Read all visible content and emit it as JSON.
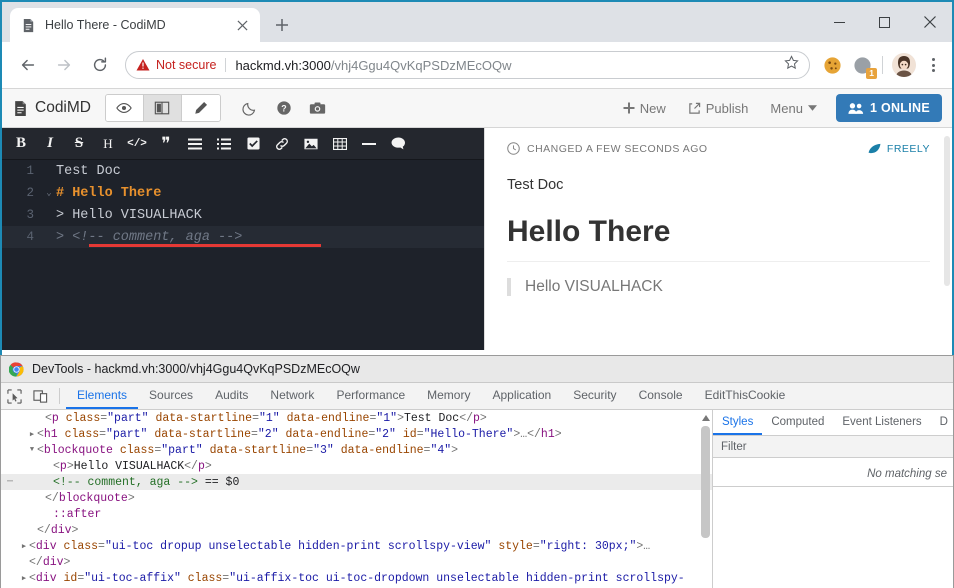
{
  "browser": {
    "tab": {
      "title": "Hello There - CodiMD",
      "favicon": "document-icon",
      "close": "×"
    },
    "new_tab_label": "+",
    "window_controls": {
      "minimize": "—",
      "maximize": "□",
      "close": "✕"
    },
    "nav": {
      "back": "←",
      "forward": "→",
      "reload": "⟳"
    },
    "omnibox": {
      "security_label": "Not secure",
      "url_host": "hackmd.vh:3000",
      "url_path": "/vhj4Ggu4QvKqPSDzMEcOQw",
      "full_url": "hackmd.vh:3000/vhj4Ggu4QvKqPSDzMEcOQw",
      "star": "☆"
    },
    "extensions": [
      {
        "name": "cookie-extension-icon",
        "badge": ""
      },
      {
        "name": "extension-icon",
        "badge": "1"
      }
    ]
  },
  "codimd": {
    "brand": "CodiMD",
    "modes": [
      {
        "name": "view-mode-button",
        "icon": "eye-icon",
        "active": false
      },
      {
        "name": "both-mode-button",
        "icon": "columns-icon",
        "active": true
      },
      {
        "name": "edit-mode-button",
        "icon": "pencil-icon",
        "active": false
      }
    ],
    "nav_icons": [
      {
        "name": "night-mode-button",
        "icon": "moon-icon"
      },
      {
        "name": "help-button",
        "icon": "question-circle-icon"
      },
      {
        "name": "snapshot-button",
        "icon": "camera-icon"
      }
    ],
    "actions": [
      {
        "name": "new-button",
        "label": "New",
        "icon": "plus-icon"
      },
      {
        "name": "publish-button",
        "label": "Publish",
        "icon": "share-icon"
      },
      {
        "name": "menu-button",
        "label": "Menu",
        "icon": "caret-down-icon"
      }
    ],
    "online_badge": {
      "label": "1 ONLINE",
      "icon": "users-icon",
      "color": "#337ab7"
    }
  },
  "editor": {
    "toolbar": [
      {
        "name": "bold-button",
        "glyph": "B"
      },
      {
        "name": "italic-button",
        "glyph": "I"
      },
      {
        "name": "strikethrough-button",
        "glyph": "S"
      },
      {
        "name": "heading-button",
        "glyph": "H"
      },
      {
        "name": "code-button",
        "glyph": "</>"
      },
      {
        "name": "quote-button",
        "glyph": "❞"
      },
      {
        "name": "unordered-list-button",
        "glyph": "☰"
      },
      {
        "name": "ordered-list-button",
        "glyph": "☰"
      },
      {
        "name": "check-list-button",
        "glyph": "☑"
      },
      {
        "name": "link-button",
        "glyph": "🔗"
      },
      {
        "name": "image-button",
        "glyph": "🖼"
      },
      {
        "name": "table-button",
        "glyph": "▦"
      },
      {
        "name": "horizontal-rule-button",
        "glyph": "—"
      },
      {
        "name": "comment-button",
        "glyph": "💬"
      }
    ],
    "lines": [
      {
        "num": "1",
        "fold": "",
        "text": "Test Doc",
        "type": "plain",
        "selected": false
      },
      {
        "num": "2",
        "fold": "⌄",
        "text": "# Hello There",
        "type": "heading",
        "selected": false
      },
      {
        "num": "3",
        "fold": "",
        "text": "> Hello VISUALHACK",
        "type": "quote",
        "selected": false
      },
      {
        "num": "4",
        "fold": "",
        "text": "> <!-- comment, aga -->",
        "type": "quotecomment",
        "selected": true
      }
    ]
  },
  "preview": {
    "status": "CHANGED A FEW SECONDS AGO",
    "status_icon": "clock-icon",
    "permission": "FREELY",
    "permission_icon": "leaf-icon",
    "paragraph": "Test Doc",
    "heading": "Hello There",
    "blockquote": "Hello VISUALHACK"
  },
  "devtools": {
    "title": "DevTools - hackmd.vh:3000/vhj4Ggu4QvKqPSDzMEcOQw",
    "tool_icons": [
      {
        "name": "inspect-element-icon"
      },
      {
        "name": "device-toolbar-icon"
      }
    ],
    "tabs": [
      {
        "label": "Elements",
        "active": true
      },
      {
        "label": "Sources",
        "active": false
      },
      {
        "label": "Audits",
        "active": false
      },
      {
        "label": "Network",
        "active": false
      },
      {
        "label": "Performance",
        "active": false
      },
      {
        "label": "Memory",
        "active": false
      },
      {
        "label": "Application",
        "active": false
      },
      {
        "label": "Security",
        "active": false
      },
      {
        "label": "Console",
        "active": false
      },
      {
        "label": "EditThisCookie",
        "active": false
      }
    ],
    "dom_lines": [
      {
        "indent": 44,
        "arrow": "",
        "gutter": "",
        "selected": false,
        "parts": [
          {
            "t": "punct",
            "v": "<"
          },
          {
            "t": "tag",
            "v": "p"
          },
          {
            "t": "attr",
            "v": " class"
          },
          {
            "t": "punct",
            "v": "="
          },
          {
            "t": "val",
            "v": "\"part\""
          },
          {
            "t": "attr",
            "v": " data-startline"
          },
          {
            "t": "punct",
            "v": "="
          },
          {
            "t": "val",
            "v": "\"1\""
          },
          {
            "t": "attr",
            "v": " data-endline"
          },
          {
            "t": "punct",
            "v": "="
          },
          {
            "t": "val",
            "v": "\"1\""
          },
          {
            "t": "punct",
            "v": ">"
          },
          {
            "t": "text",
            "v": "Test Doc"
          },
          {
            "t": "punct",
            "v": "</"
          },
          {
            "t": "tag",
            "v": "p"
          },
          {
            "t": "punct",
            "v": ">"
          }
        ]
      },
      {
        "indent": 36,
        "arrow": "▶",
        "gutter": "",
        "selected": false,
        "parts": [
          {
            "t": "punct",
            "v": "<"
          },
          {
            "t": "tag",
            "v": "h1"
          },
          {
            "t": "attr",
            "v": " class"
          },
          {
            "t": "punct",
            "v": "="
          },
          {
            "t": "val",
            "v": "\"part\""
          },
          {
            "t": "attr",
            "v": " data-startline"
          },
          {
            "t": "punct",
            "v": "="
          },
          {
            "t": "val",
            "v": "\"2\""
          },
          {
            "t": "attr",
            "v": " data-endline"
          },
          {
            "t": "punct",
            "v": "="
          },
          {
            "t": "val",
            "v": "\"2\""
          },
          {
            "t": "attr",
            "v": " id"
          },
          {
            "t": "punct",
            "v": "="
          },
          {
            "t": "val",
            "v": "\"Hello-There\""
          },
          {
            "t": "punct",
            "v": ">…</"
          },
          {
            "t": "tag",
            "v": "h1"
          },
          {
            "t": "punct",
            "v": ">"
          }
        ]
      },
      {
        "indent": 36,
        "arrow": "▼",
        "gutter": "",
        "selected": false,
        "parts": [
          {
            "t": "punct",
            "v": "<"
          },
          {
            "t": "tag",
            "v": "blockquote"
          },
          {
            "t": "attr",
            "v": " class"
          },
          {
            "t": "punct",
            "v": "="
          },
          {
            "t": "val",
            "v": "\"part\""
          },
          {
            "t": "attr",
            "v": " data-startline"
          },
          {
            "t": "punct",
            "v": "="
          },
          {
            "t": "val",
            "v": "\"3\""
          },
          {
            "t": "attr",
            "v": " data-endline"
          },
          {
            "t": "punct",
            "v": "="
          },
          {
            "t": "val",
            "v": "\"4\""
          },
          {
            "t": "punct",
            "v": ">"
          }
        ]
      },
      {
        "indent": 52,
        "arrow": "",
        "gutter": "",
        "selected": false,
        "parts": [
          {
            "t": "punct",
            "v": "<"
          },
          {
            "t": "tag",
            "v": "p"
          },
          {
            "t": "punct",
            "v": ">"
          },
          {
            "t": "text",
            "v": "Hello VISUALHACK"
          },
          {
            "t": "punct",
            "v": "</"
          },
          {
            "t": "tag",
            "v": "p"
          },
          {
            "t": "punct",
            "v": ">"
          }
        ]
      },
      {
        "indent": 52,
        "arrow": "",
        "gutter": "⋯",
        "selected": true,
        "parts": [
          {
            "t": "comment",
            "v": "<!-- comment, aga -->"
          },
          {
            "t": "dollar",
            "v": " == $0"
          }
        ]
      },
      {
        "indent": 44,
        "arrow": "",
        "gutter": "",
        "selected": false,
        "parts": [
          {
            "t": "punct",
            "v": "</"
          },
          {
            "t": "tag",
            "v": "blockquote"
          },
          {
            "t": "punct",
            "v": ">"
          }
        ]
      },
      {
        "indent": 52,
        "arrow": "",
        "gutter": "",
        "selected": false,
        "parts": [
          {
            "t": "pseudo",
            "v": "::after"
          }
        ]
      },
      {
        "indent": 36,
        "arrow": "",
        "gutter": "",
        "selected": false,
        "parts": [
          {
            "t": "punct",
            "v": "</"
          },
          {
            "t": "tag",
            "v": "div"
          },
          {
            "t": "punct",
            "v": ">"
          }
        ]
      },
      {
        "indent": 28,
        "arrow": "▶",
        "gutter": "",
        "selected": false,
        "parts": [
          {
            "t": "punct",
            "v": "<"
          },
          {
            "t": "tag",
            "v": "div"
          },
          {
            "t": "attr",
            "v": " class"
          },
          {
            "t": "punct",
            "v": "="
          },
          {
            "t": "val",
            "v": "\"ui-toc dropup unselectable hidden-print scrollspy-view\""
          },
          {
            "t": "attr",
            "v": " style"
          },
          {
            "t": "punct",
            "v": "="
          },
          {
            "t": "val",
            "v": "\"right: 30px;\""
          },
          {
            "t": "punct",
            "v": ">…"
          }
        ]
      },
      {
        "indent": 28,
        "arrow": "",
        "gutter": "",
        "selected": false,
        "parts": [
          {
            "t": "punct",
            "v": "</"
          },
          {
            "t": "tag",
            "v": "div"
          },
          {
            "t": "punct",
            "v": ">"
          }
        ]
      },
      {
        "indent": 28,
        "arrow": "▶",
        "gutter": "",
        "selected": false,
        "parts": [
          {
            "t": "punct",
            "v": "<"
          },
          {
            "t": "tag",
            "v": "div"
          },
          {
            "t": "attr",
            "v": " id"
          },
          {
            "t": "punct",
            "v": "="
          },
          {
            "t": "val",
            "v": "\"ui-toc-affix\""
          },
          {
            "t": "attr",
            "v": " class"
          },
          {
            "t": "punct",
            "v": "="
          },
          {
            "t": "val",
            "v": "\"ui-affix-toc ui-toc-dropdown unselectable hidden-print scrollspy-"
          }
        ]
      }
    ],
    "styles": {
      "tabs": [
        {
          "label": "Styles",
          "active": true
        },
        {
          "label": "Computed",
          "active": false
        },
        {
          "label": "Event Listeners",
          "active": false
        },
        {
          "label": "D",
          "active": false
        }
      ],
      "filter_placeholder": "Filter",
      "empty_message": "No matching se"
    }
  }
}
